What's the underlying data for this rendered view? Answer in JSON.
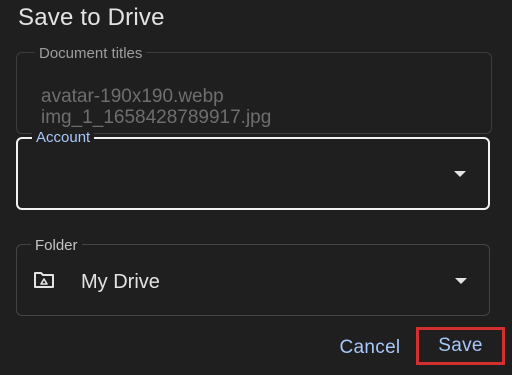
{
  "dialog": {
    "title": "Save to Drive"
  },
  "document_titles": {
    "label": "Document titles",
    "lines": [
      "avatar-190x190.webp",
      "img_1_1658428789917.jpg"
    ]
  },
  "account": {
    "label": "Account",
    "value": ""
  },
  "folder": {
    "label": "Folder",
    "value": "My Drive",
    "icon": "drive-folder-icon"
  },
  "actions": {
    "cancel_label": "Cancel",
    "save_label": "Save"
  },
  "colors": {
    "background": "#1f1f1f",
    "accent": "#a8c7fa",
    "highlight": "#d32f2f"
  }
}
